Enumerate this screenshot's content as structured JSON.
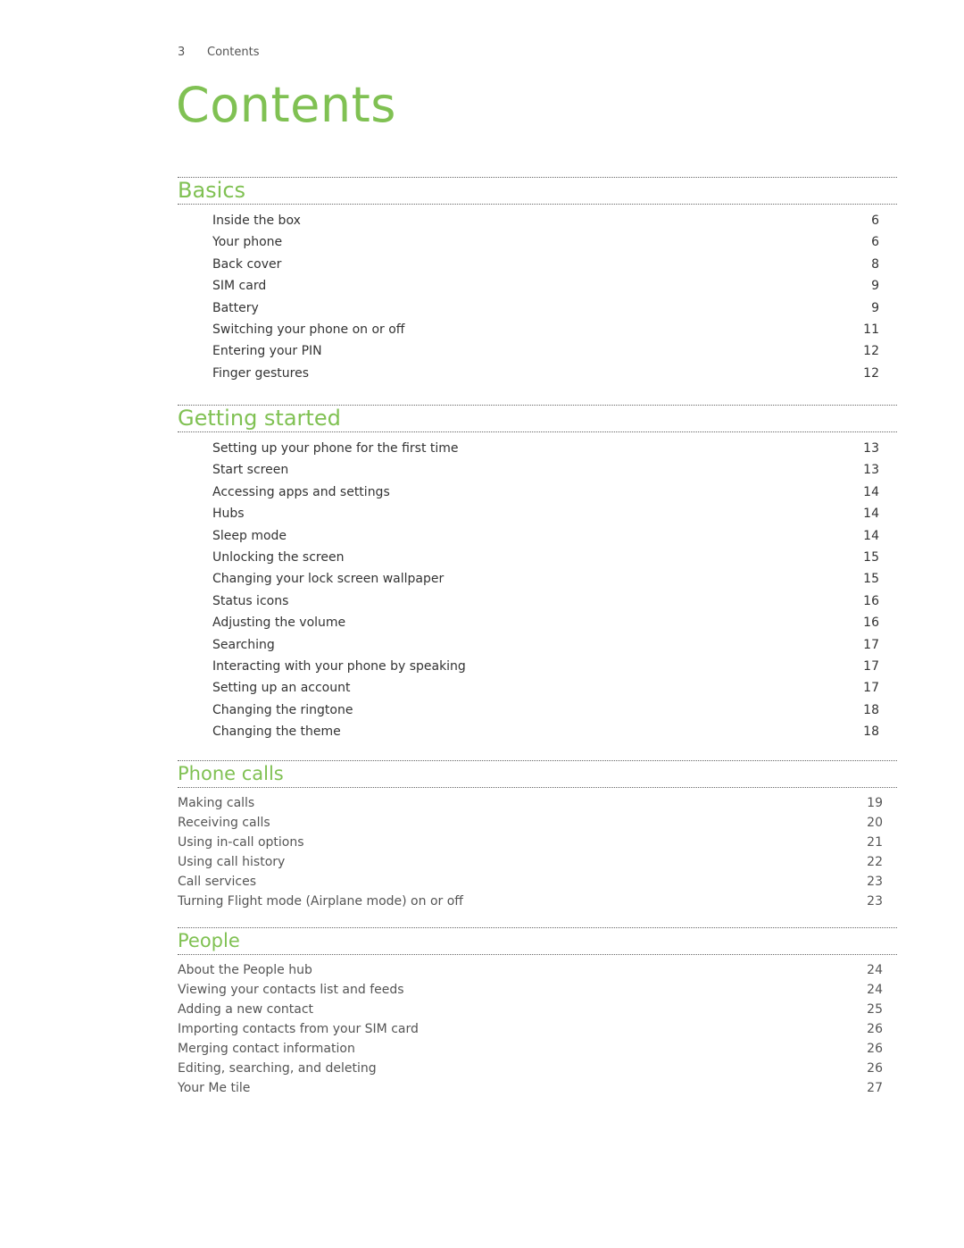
{
  "running_head": {
    "page_number": "3",
    "title": "Contents"
  },
  "title": "Contents",
  "colors": {
    "accent": "#80c153"
  },
  "sections": [
    {
      "heading": "Basics",
      "entries": [
        {
          "label": "Inside the box",
          "page": "6"
        },
        {
          "label": "Your phone",
          "page": "6"
        },
        {
          "label": "Back cover",
          "page": "8"
        },
        {
          "label": "SIM card",
          "page": "9"
        },
        {
          "label": "Battery",
          "page": "9"
        },
        {
          "label": "Switching your phone on or off",
          "page": "11"
        },
        {
          "label": "Entering your PIN",
          "page": "12"
        },
        {
          "label": "Finger gestures",
          "page": "12"
        }
      ]
    },
    {
      "heading": "Getting started",
      "entries": [
        {
          "label": "Setting up your phone for the first time",
          "page": "13"
        },
        {
          "label": "Start screen",
          "page": "13"
        },
        {
          "label": "Accessing apps and settings",
          "page": "14"
        },
        {
          "label": "Hubs",
          "page": "14"
        },
        {
          "label": "Sleep mode",
          "page": "14"
        },
        {
          "label": "Unlocking the screen",
          "page": "15"
        },
        {
          "label": "Changing your lock screen wallpaper",
          "page": "15"
        },
        {
          "label": "Status icons",
          "page": "16"
        },
        {
          "label": "Adjusting the volume",
          "page": "16"
        },
        {
          "label": "Searching",
          "page": "17"
        },
        {
          "label": "Interacting with your phone by speaking",
          "page": "17"
        },
        {
          "label": "Setting up an account",
          "page": "17"
        },
        {
          "label": "Changing the ringtone",
          "page": "18"
        },
        {
          "label": "Changing the theme",
          "page": "18"
        }
      ]
    },
    {
      "heading": "Phone calls",
      "entries": [
        {
          "label": "Making calls",
          "page": "19"
        },
        {
          "label": "Receiving calls",
          "page": "20"
        },
        {
          "label": "Using in-call options",
          "page": "21"
        },
        {
          "label": "Using call history",
          "page": "22"
        },
        {
          "label": "Call services",
          "page": "23"
        },
        {
          "label": "Turning Flight mode (Airplane mode) on or off",
          "page": "23"
        }
      ]
    },
    {
      "heading": "People",
      "entries": [
        {
          "label": "About the People hub",
          "page": "24"
        },
        {
          "label": "Viewing your contacts list and feeds",
          "page": "24"
        },
        {
          "label": "Adding a new contact",
          "page": "25"
        },
        {
          "label": "Importing contacts from your SIM card",
          "page": "26"
        },
        {
          "label": "Merging contact information",
          "page": "26"
        },
        {
          "label": "Editing, searching, and deleting",
          "page": "26"
        },
        {
          "label": "Your Me tile",
          "page": "27"
        }
      ]
    }
  ]
}
